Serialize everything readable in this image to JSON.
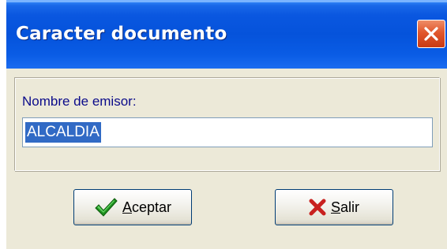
{
  "window": {
    "title": "Caracter documento",
    "close_icon": "close-x-icon"
  },
  "form": {
    "issuer_label": "Nombre de emisor:",
    "issuer_value": "ALCALDIA"
  },
  "buttons": {
    "accept_mnemonic": "A",
    "accept_rest": "ceptar",
    "accept_icon": "green-checkmark-icon",
    "exit_mnemonic": "S",
    "exit_rest": "alir",
    "exit_icon": "red-x-icon"
  },
  "colors": {
    "titlebar": "#0553db",
    "dialog_bg": "#ece9d8",
    "label_text": "#0b0b8a",
    "selection": "#316ac5",
    "close_button": "#e1572c",
    "check_green": "#1f8f1f",
    "x_red": "#c8201e"
  }
}
